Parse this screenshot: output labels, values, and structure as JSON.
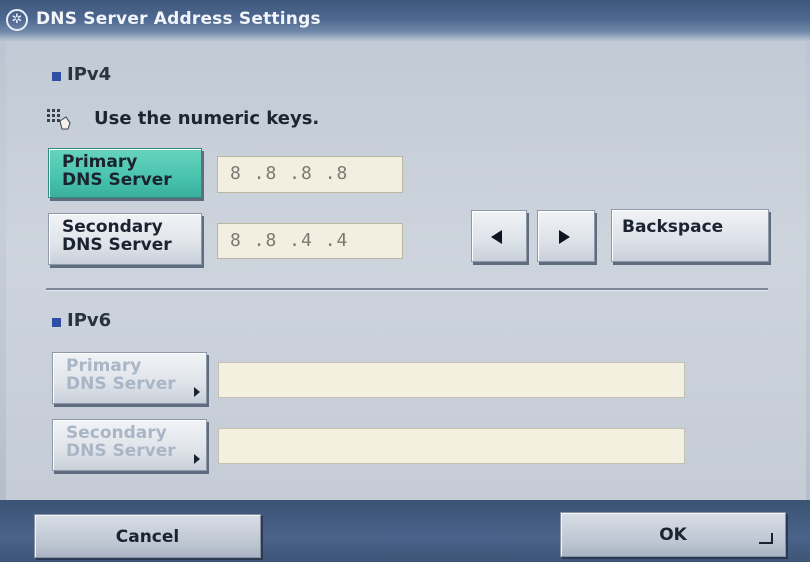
{
  "window": {
    "title": "DNS Server Address Settings",
    "title_icon": "gear-circle-icon"
  },
  "ipv4": {
    "section_label": "IPv4",
    "hint_icon": "numeric-keypad-hand-icon",
    "hint": "Use the numeric keys.",
    "primary": {
      "label_line1": "Primary",
      "label_line2": "DNS Server",
      "value": "8 .8 .8 .8",
      "selected": true
    },
    "secondary": {
      "label_line1": "Secondary",
      "label_line2": "DNS Server",
      "value": "8 .8 .4 .4",
      "selected": false
    }
  },
  "cursor_controls": {
    "left_icon": "left-arrow-icon",
    "right_icon": "right-arrow-icon",
    "backspace_label": "Backspace"
  },
  "ipv6": {
    "section_label": "IPv6",
    "primary": {
      "label_line1": "Primary",
      "label_line2": "DNS Server",
      "value": "",
      "enabled": false
    },
    "secondary": {
      "label_line1": "Secondary",
      "label_line2": "DNS Server",
      "value": "",
      "enabled": false
    }
  },
  "footer": {
    "cancel_label": "Cancel",
    "ok_label": "OK"
  },
  "colors": {
    "title_bar": "#4d6790",
    "selected_button": "#48c3ad",
    "field_background": "#f2efe0",
    "section_marker": "#2f4fa6"
  }
}
